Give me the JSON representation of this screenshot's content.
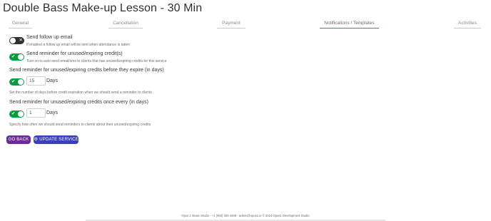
{
  "page": {
    "title": "Double Bass Make-up Lesson - 30 Min"
  },
  "tabs": [
    {
      "label": "General"
    },
    {
      "label": "Cancellation"
    },
    {
      "label": "Payment"
    },
    {
      "label": "Notifications / Templates",
      "active": true
    },
    {
      "label": "Activities"
    }
  ],
  "settings": {
    "follow_up": {
      "label": "Send follow up email",
      "help": "If enabled a follow up email will be sent when attendance is taken",
      "enabled": false,
      "toggle_mark": "✕"
    },
    "reminder": {
      "label": "Send reminder for unused/expiring credit(s)",
      "help": "Turn on to auto send email/sms to clients that has unused/expiring credits for this service",
      "enabled": true,
      "toggle_mark": "✔"
    },
    "before_expire": {
      "label": "Send reminder for unused/expiring credits before they expire (in days)",
      "enabled": true,
      "toggle_mark": "✔",
      "value": "15",
      "unit": "Days",
      "help": "Set the number of days before credit expiration when we should send a reminder to clients"
    },
    "once_every": {
      "label": "Send reminder for unused/expiring credits once every (in days)",
      "enabled": true,
      "toggle_mark": "✔",
      "value": "1",
      "unit": "Days",
      "help": "Specify how often we should send reminders to clients about their unused/expiring credits"
    }
  },
  "actions": {
    "back_label": "GO BACK",
    "update_label": "UPDATE SERVICE",
    "update_icon": "gear-icon"
  },
  "footer": {
    "text": "Opus 1 Music Studio - +1 (650) 384-4848 - admin@opus1.io © 2024 Opus1 Development Studio"
  },
  "colors": {
    "toggle_on": "#0d9b3f",
    "toggle_off": "#2f2f2f",
    "back_button": "#6e2a9a",
    "update_button": "#3a3fbd",
    "active_tab_line": "#4b76c4"
  }
}
